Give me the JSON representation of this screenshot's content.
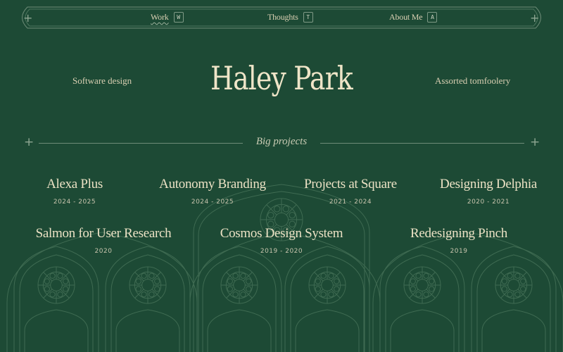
{
  "nav": {
    "items": [
      {
        "label": "Work",
        "key": "W"
      },
      {
        "label": "Thoughts",
        "key": "T"
      },
      {
        "label": "About Me",
        "key": "A"
      }
    ]
  },
  "header": {
    "title": "Haley Park",
    "left_tagline": "Software design",
    "right_tagline": "Assorted tomfoolery"
  },
  "section": {
    "title": "Big projects"
  },
  "projects": [
    {
      "name": "Alexa Plus",
      "years": "2024 - 2025"
    },
    {
      "name": "Autonomy Branding",
      "years": "2024 - 2025"
    },
    {
      "name": "Projects at Square",
      "years": "2021 - 2024"
    },
    {
      "name": "Designing Delphia",
      "years": "2020 - 2021"
    },
    {
      "name": "Salmon for User Research",
      "years": "2020"
    },
    {
      "name": "Cosmos Design System",
      "years": "2019 - 2020"
    },
    {
      "name": "Redesigning Pinch",
      "years": "2019"
    }
  ],
  "colors": {
    "background": "#1d4a35",
    "text": "#e6dcc0",
    "line": "#6f8c78"
  }
}
